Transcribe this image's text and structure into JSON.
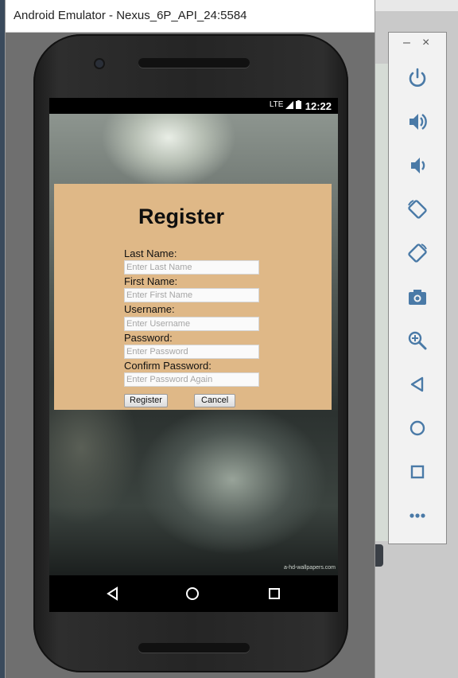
{
  "window": {
    "title": "Android Emulator - Nexus_6P_API_24:5584"
  },
  "status_bar": {
    "network": "LTE",
    "time": "12:22"
  },
  "register_form": {
    "title": "Register",
    "fields": [
      {
        "label": "Last Name:",
        "placeholder": "Enter Last Name"
      },
      {
        "label": "First Name:",
        "placeholder": "Enter First Name"
      },
      {
        "label": "Username:",
        "placeholder": "Enter Username"
      },
      {
        "label": "Password:",
        "placeholder": "Enter Password"
      },
      {
        "label": "Confirm Password:",
        "placeholder": "Enter Password Again"
      }
    ],
    "register_button": "Register",
    "cancel_button": "Cancel",
    "background_color": "#dfb887"
  },
  "wallpaper": {
    "watermark": "a-hd-wallpapers.com"
  },
  "nav_bar": {
    "icons": [
      "back-icon",
      "home-icon",
      "recent-apps-icon"
    ]
  },
  "side_toolbar": {
    "minimize": "–",
    "close": "×",
    "icons": [
      "power-icon",
      "volume-up-icon",
      "volume-down-icon",
      "rotate-left-icon",
      "rotate-right-icon",
      "camera-icon",
      "zoom-icon",
      "back-icon",
      "home-icon",
      "overview-icon",
      "more-icon"
    ],
    "accent_color": "#4a7aa7"
  }
}
